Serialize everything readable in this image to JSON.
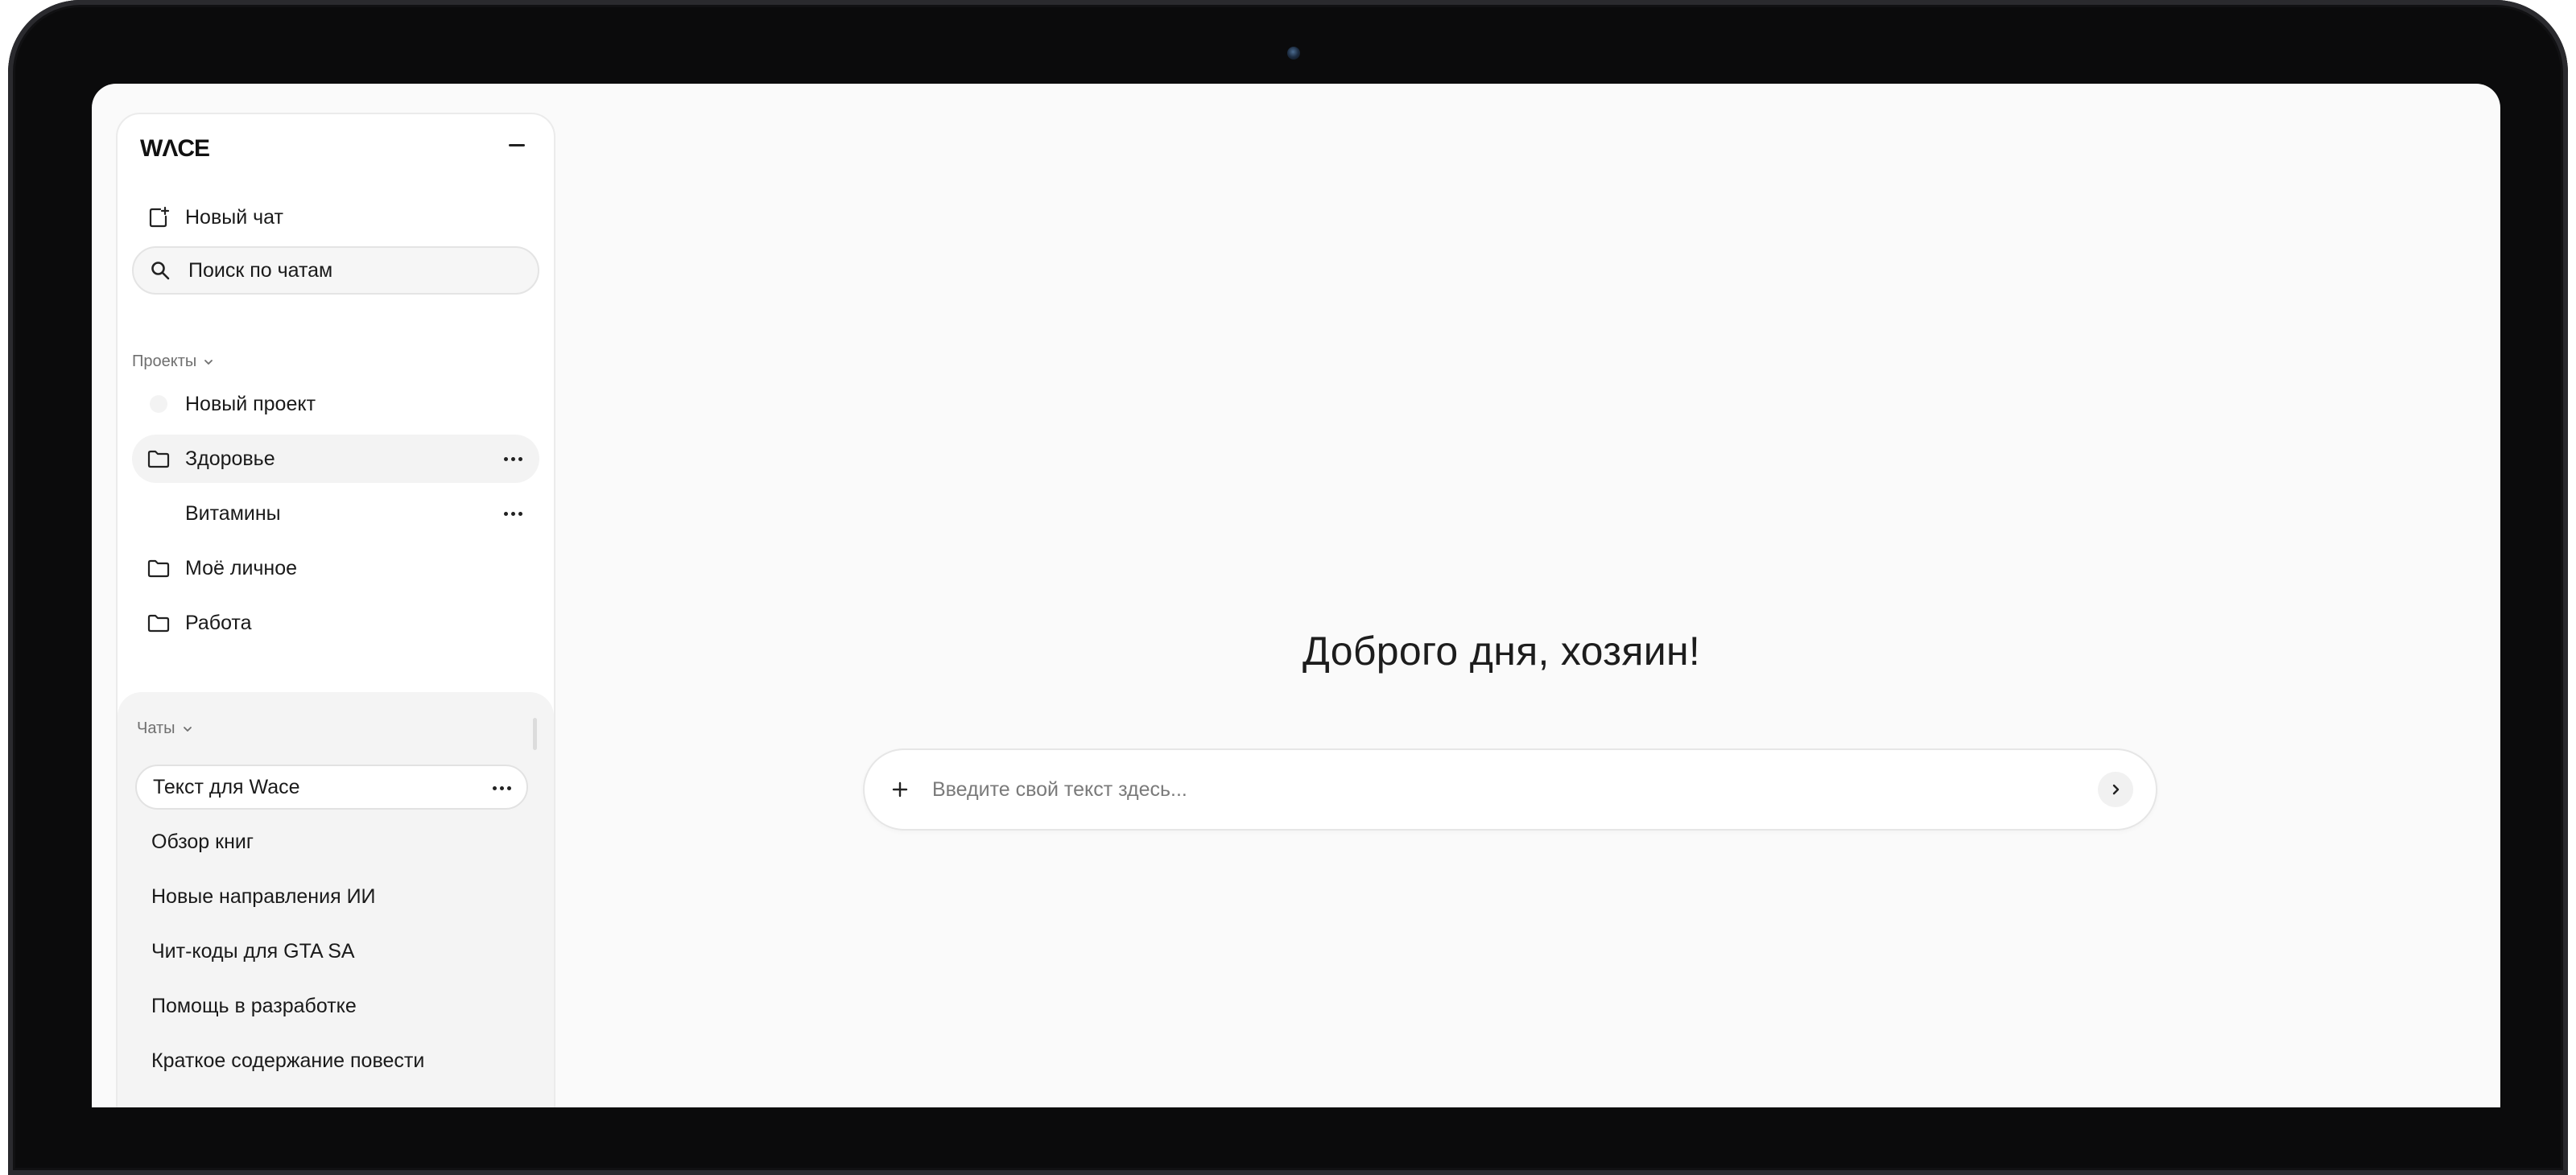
{
  "app": {
    "logo": "WΛCE",
    "greeting": "Доброго дня, хозяин!"
  },
  "sidebar": {
    "new_chat_label": "Новый чат",
    "search_placeholder": "Поиск по чатам",
    "projects_label": "Проекты",
    "projects": [
      {
        "label": "Новый проект",
        "icon": "new-project-icon"
      },
      {
        "label": "Здоровье",
        "icon": "folder-icon",
        "active": true
      },
      {
        "label": "Витамины",
        "icon": "none",
        "sub": true
      },
      {
        "label": "Моё личное",
        "icon": "folder-icon"
      },
      {
        "label": "Работа",
        "icon": "folder-icon"
      }
    ],
    "chats_label": "Чаты",
    "chats": [
      {
        "label": "Текст для Wace",
        "selected": true
      },
      {
        "label": "Обзор книг"
      },
      {
        "label": "Новые направления ИИ"
      },
      {
        "label": "Чит-коды для GTA SA"
      },
      {
        "label": "Помощь в разработке"
      },
      {
        "label": "Краткое содержание повести"
      }
    ]
  },
  "composer": {
    "placeholder": "Введите свой текст здесь..."
  },
  "colors": {
    "screen_bg": "#fafafa",
    "sidebar_bg": "#ffffff",
    "chats_panel_bg": "#f4f4f4",
    "device_frame": "#0b0b0c"
  }
}
